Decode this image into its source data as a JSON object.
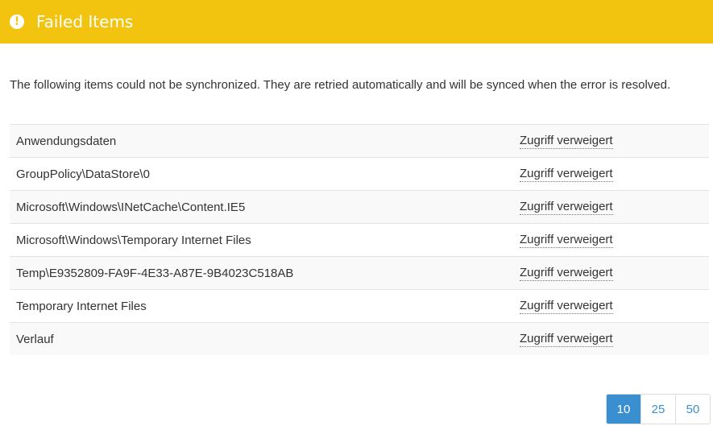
{
  "header": {
    "title": "Failed Items",
    "icon": "exclamation-circle-icon",
    "background_color": "#f2c40f"
  },
  "description": "The following items could not be synchronized. They are retried automatically and will be synced when the error is resolved.",
  "items": [
    {
      "path": "Anwendungsdaten",
      "error": "Zugriff verweigert"
    },
    {
      "path": "GroupPolicy\\DataStore\\0",
      "error": "Zugriff verweigert"
    },
    {
      "path": "Microsoft\\Windows\\INetCache\\Content.IE5",
      "error": "Zugriff verweigert"
    },
    {
      "path": "Microsoft\\Windows\\Temporary Internet Files",
      "error": "Zugriff verweigert"
    },
    {
      "path": "Temp\\E9352809-FA9F-4E33-A87E-9B4023C518AB",
      "error": "Zugriff verweigert"
    },
    {
      "path": "Temporary Internet Files",
      "error": "Zugriff verweigert"
    },
    {
      "path": "Verlauf",
      "error": "Zugriff verweigert"
    }
  ],
  "pager": {
    "options": [
      "10",
      "25",
      "50"
    ],
    "selected": "10",
    "accent_color": "#3a8fd0"
  }
}
